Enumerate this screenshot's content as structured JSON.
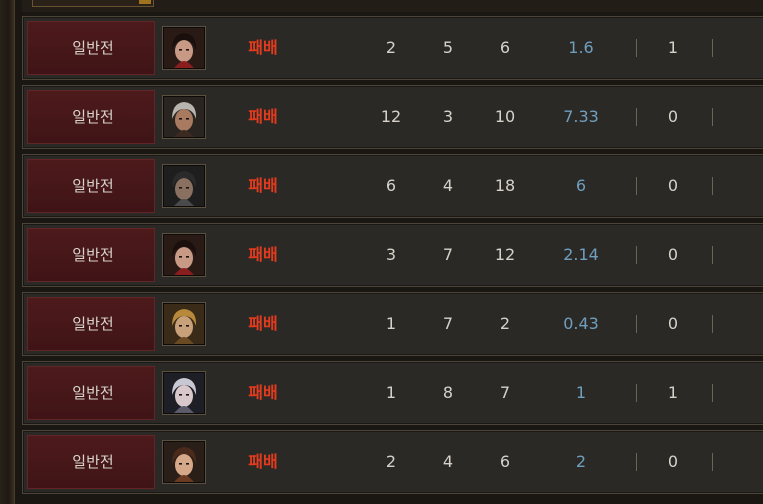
{
  "matches": [
    {
      "mode": "일반전",
      "portrait": "character-portrait-dark-hair-red-icon",
      "result": "패배",
      "kills": "2",
      "deaths": "5",
      "assists": "6",
      "kda": "1.6",
      "extra": "1"
    },
    {
      "mode": "일반전",
      "portrait": "character-portrait-white-hair-icon",
      "result": "패배",
      "kills": "12",
      "deaths": "3",
      "assists": "10",
      "kda": "7.33",
      "extra": "0"
    },
    {
      "mode": "일반전",
      "portrait": "character-portrait-hooded-icon",
      "result": "패배",
      "kills": "6",
      "deaths": "4",
      "assists": "18",
      "kda": "6",
      "extra": "0"
    },
    {
      "mode": "일반전",
      "portrait": "character-portrait-dark-hair-red-icon",
      "result": "패배",
      "kills": "3",
      "deaths": "7",
      "assists": "12",
      "kda": "2.14",
      "extra": "0"
    },
    {
      "mode": "일반전",
      "portrait": "character-portrait-blond-icon",
      "result": "패배",
      "kills": "1",
      "deaths": "7",
      "assists": "2",
      "kda": "0.43",
      "extra": "0"
    },
    {
      "mode": "일반전",
      "portrait": "character-portrait-silver-hair-icon",
      "result": "패배",
      "kills": "1",
      "deaths": "8",
      "assists": "7",
      "kda": "1",
      "extra": "1"
    },
    {
      "mode": "일반전",
      "portrait": "character-portrait-brown-hair-icon",
      "result": "패배",
      "kills": "2",
      "deaths": "4",
      "assists": "6",
      "kda": "2",
      "extra": "0"
    }
  ],
  "colors": {
    "result_loss": "#e23b1e",
    "kda": "#6f9fbf",
    "mode_bg": "#4e1a1c",
    "row_bg": "#2b2926"
  }
}
